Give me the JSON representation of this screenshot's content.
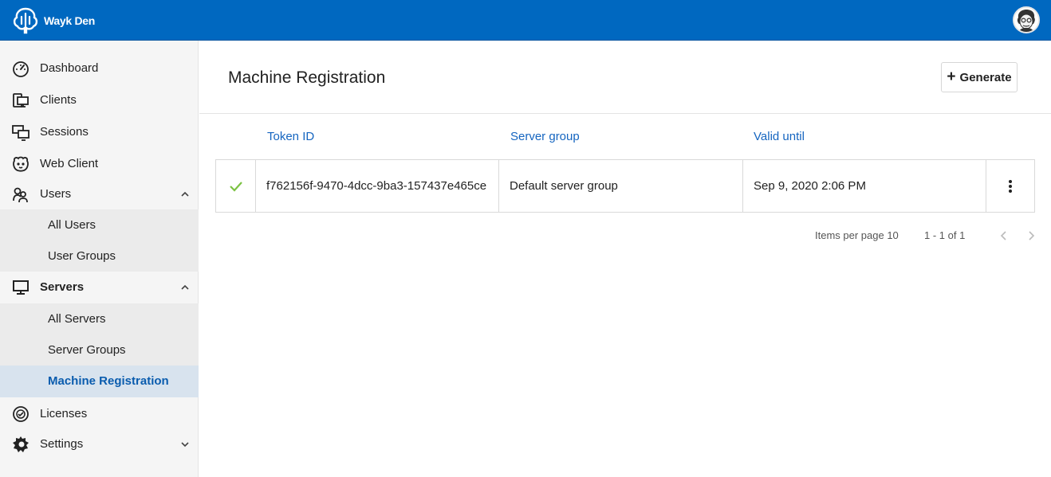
{
  "app": {
    "name": "Wayk Den"
  },
  "sidebar": {
    "items": [
      {
        "label": "Dashboard",
        "icon": "dashboard-icon"
      },
      {
        "label": "Clients",
        "icon": "clients-icon"
      },
      {
        "label": "Sessions",
        "icon": "sessions-icon"
      },
      {
        "label": "Web Client",
        "icon": "web-client-icon"
      },
      {
        "label": "Users",
        "icon": "users-icon",
        "expanded": true
      },
      {
        "label": "Servers",
        "icon": "servers-icon",
        "expanded": true
      },
      {
        "label": "Licenses",
        "icon": "licenses-icon"
      },
      {
        "label": "Settings",
        "icon": "settings-icon",
        "expanded": false
      }
    ],
    "users_sub": [
      {
        "label": "All Users"
      },
      {
        "label": "User Groups"
      }
    ],
    "servers_sub": [
      {
        "label": "All Servers"
      },
      {
        "label": "Server Groups"
      },
      {
        "label": "Machine Registration",
        "active": true
      }
    ]
  },
  "main": {
    "title": "Machine Registration",
    "generate_label": "Generate",
    "columns": [
      "Token ID",
      "Server group",
      "Valid until"
    ],
    "rows": [
      {
        "status": "valid",
        "token_id": "f762156f-9470-4dcc-9ba3-157437e465ce",
        "server_group": "Default server group",
        "valid_until": "Sep 9, 2020 2:06 PM"
      }
    ],
    "pager": {
      "items_per_page": "Items per page 10",
      "range": "1 - 1 of 1"
    }
  },
  "colors": {
    "topbar": "#0068c0",
    "accent": "#1565c0",
    "active_bg": "#d8e3ee",
    "check": "#7cc243"
  }
}
